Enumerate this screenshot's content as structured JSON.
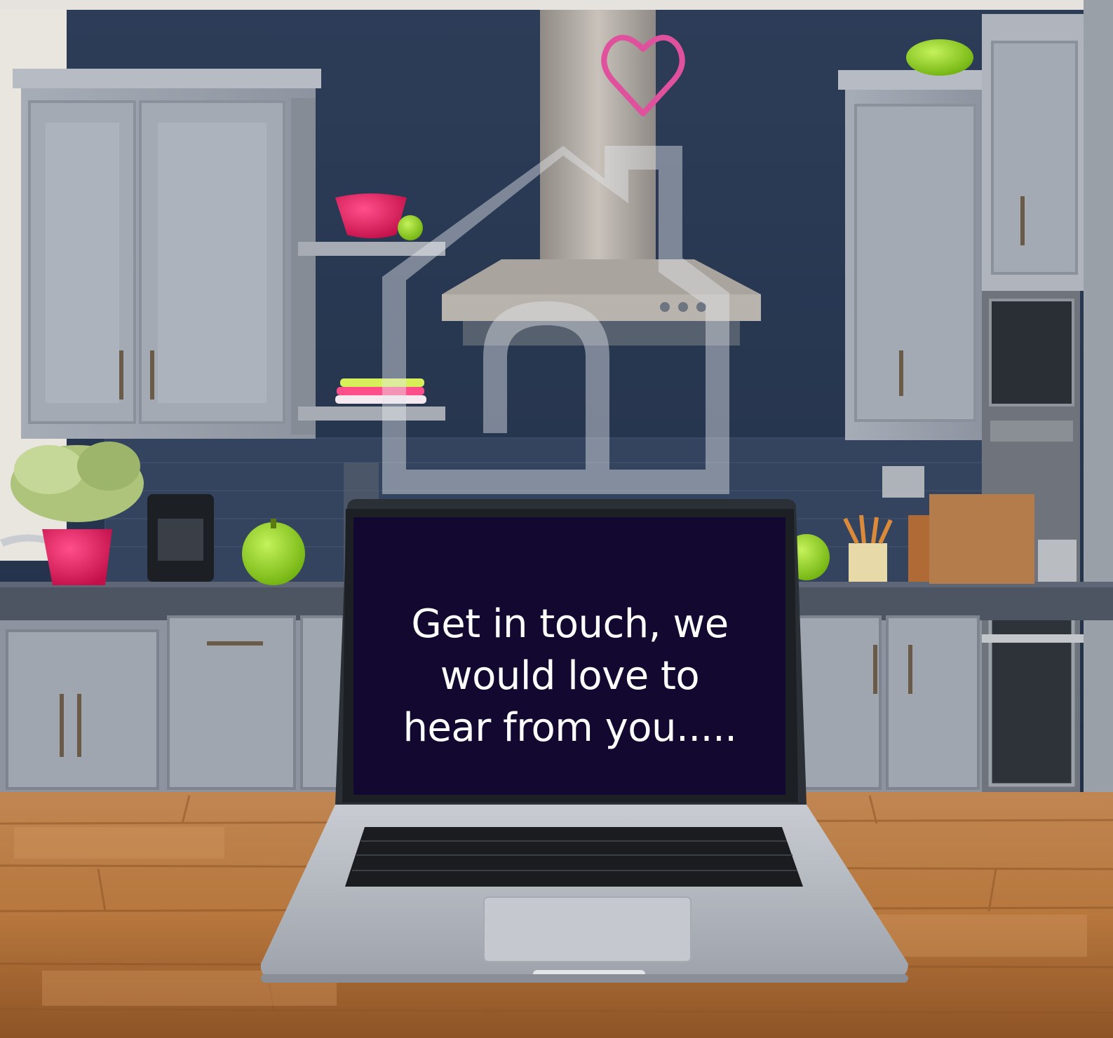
{
  "screen": {
    "line1": "Get in touch, we",
    "line2": "would love to",
    "line3": "hear from you....."
  },
  "icons": {
    "logo": "house-with-heart-icon"
  },
  "colors": {
    "wall": "#27364f",
    "cabinet": "#9aa0aa",
    "countertop_wood": "#b57a45",
    "screen_bg": "#13082f",
    "heart": "#e0519d",
    "accent_pink": "#e8195e",
    "accent_green": "#8fd61c"
  }
}
